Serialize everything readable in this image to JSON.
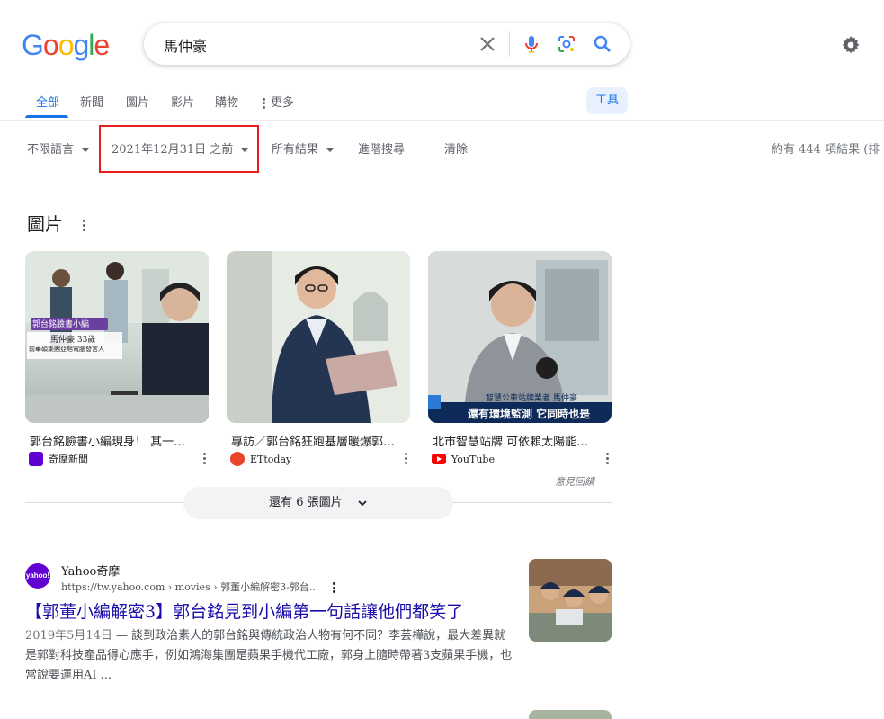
{
  "logo": {
    "text": "Google",
    "letters": [
      "G",
      "o",
      "o",
      "g",
      "l",
      "e"
    ],
    "colors": [
      "#4285F4",
      "#EA4335",
      "#FBBC05",
      "#4285F4",
      "#34A853",
      "#EA4335"
    ]
  },
  "search": {
    "query": "馬仲豪"
  },
  "icons": {
    "clear": "close-icon",
    "voice": "microphone-icon",
    "lens": "camera-lens-icon",
    "search": "search-icon",
    "settings": "gear-icon"
  },
  "tabs": [
    {
      "label": "全部",
      "active": true
    },
    {
      "label": "新聞"
    },
    {
      "label": "圖片"
    },
    {
      "label": "影片"
    },
    {
      "label": "購物"
    },
    {
      "label": "更多"
    }
  ],
  "tools_label": "工具",
  "filters": {
    "language": "不限語言",
    "date": "2021年12月31日 之前",
    "results": "所有結果",
    "advanced": "進階搜尋",
    "clear": "清除",
    "count": "約有 444 項結果 (排"
  },
  "images": {
    "heading": "圖片",
    "cards": [
      {
        "caption": "郭台銘臉書小編現身！ 其一…",
        "source": "奇摩新聞",
        "overlay_1": "郭台銘臉書小編",
        "overlay_2": "馬仲豪 33歲",
        "overlay_3": "前華碩集團亞旭電腦發言人"
      },
      {
        "caption": "專訪／郭台銘狂跑基層暖爆郭…",
        "source": "ETtoday"
      },
      {
        "caption": "北市智慧站牌 可依賴太陽能…",
        "source": "YouTube",
        "overlay_1": "智慧公車站牌業者 馬仲豪",
        "overlay_2": "還有環境監測 它同時也是"
      }
    ],
    "feedback": "意見回饋",
    "more": "還有 6 張圖片"
  },
  "result": {
    "site": "Yahoo奇摩",
    "favicon_text": "yahoo!",
    "url": "https://tw.yahoo.com › movies › 郭董小編解密3-郭台...",
    "title": "【郭董小編解密3】郭台銘見到小編第一句話讓他們都笑了",
    "date": "2019年5月14日",
    "snippet": " — 談到政治素人的郭台銘與傳統政治人物有何不同？李芸樺說，最大差異就是郭對科技產品得心應手，例如鴻海集團是蘋果手機代工廠，郭身上隨時帶著3支蘋果手機，也常說要運用AI ..."
  }
}
